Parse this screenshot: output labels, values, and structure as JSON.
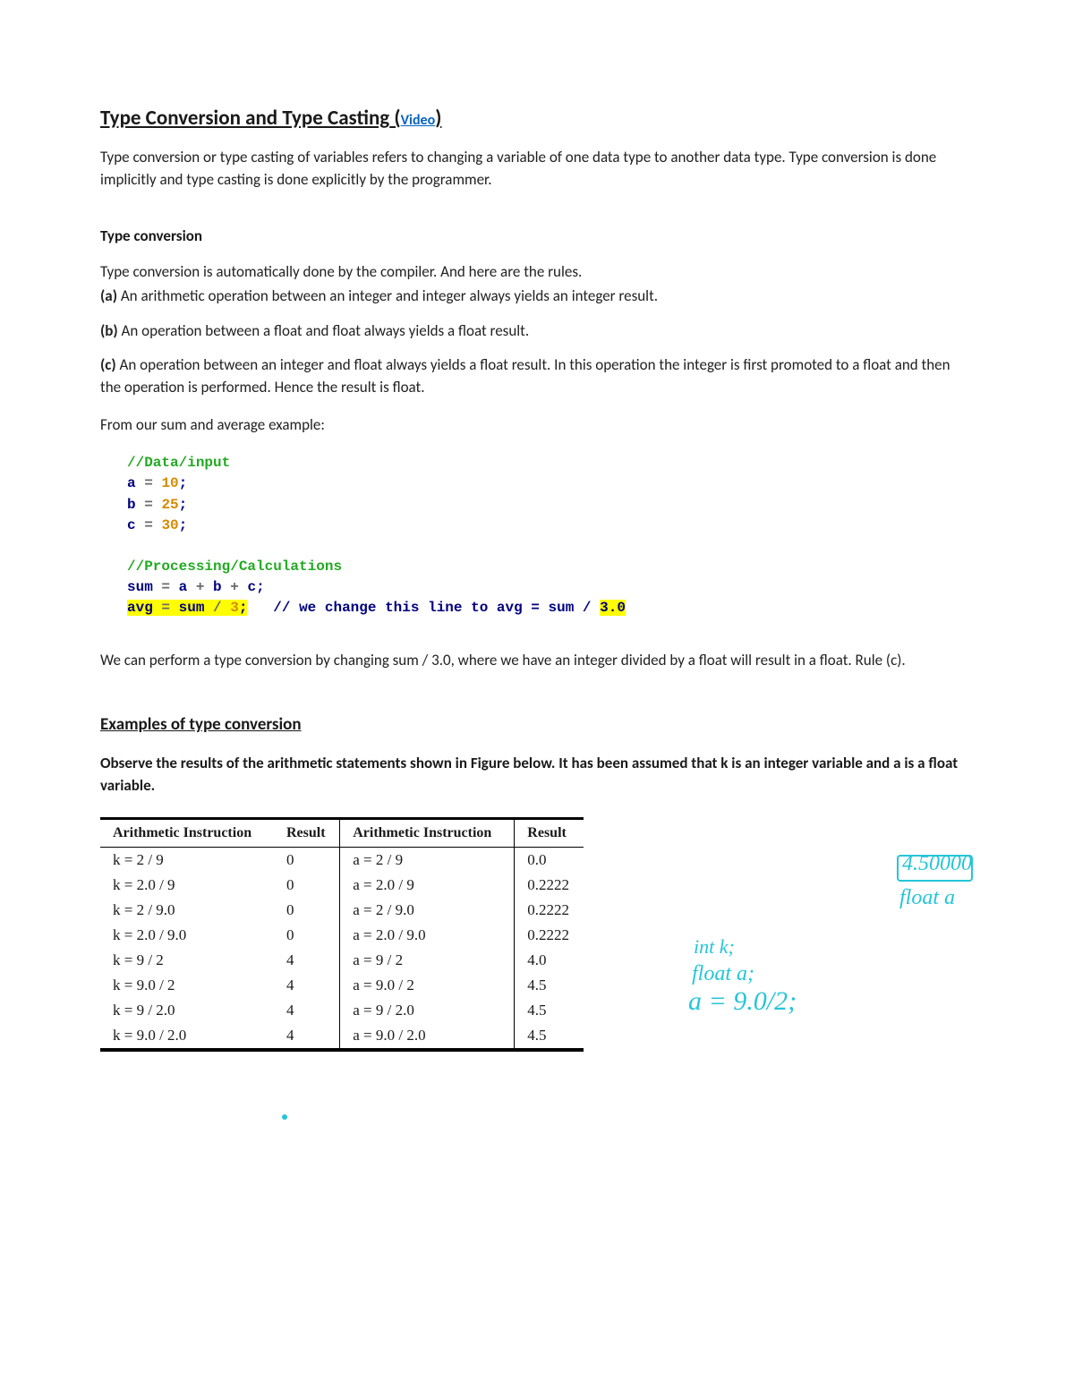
{
  "title": {
    "main": "Type Conversion and Type Casting",
    "paren_open": " (",
    "link_text": "Video",
    "paren_close": ")"
  },
  "intro": "Type conversion or type casting of variables refers to changing a variable of one data type to another data type. Type conversion is done implicitly and type casting is done explicitly by the programmer.",
  "section_heading": "Type conversion",
  "rules_intro": "Type conversion is automatically done by the compiler. And here are the rules.",
  "rule_a_prefix": "(a)",
  "rule_a_text": " An arithmetic operation between an integer and integer always yields an integer result.",
  "rule_b_prefix": "(b)",
  "rule_b_text": " An operation between a float and float always yields a float result.",
  "rule_c_prefix": "(c)",
  "rule_c_text": " An operation between an integer and float always yields a float result. In this operation the integer is first promoted to a float and then the operation is performed. Hence the result is float.",
  "from_example": "From our sum and average example:",
  "code": {
    "comment1": "//Data/input",
    "a": "a",
    "eq": "=",
    "v10": "10",
    "b": "b",
    "v25": "25",
    "c": "c",
    "v30": "30",
    "semi": ";",
    "comment2": "//Processing/Calculations",
    "sum_line": "sum ",
    "plus1": "a ",
    "plus": "+",
    "space": " ",
    "plus2": " b ",
    "plus3": " c",
    "avg": "avg ",
    "sumvar": " sum ",
    "slash": "/",
    "three": " 3",
    "comment3": "   // we change this line to avg = sum / ",
    "threezero": "3.0"
  },
  "after_code": "We can perform a type conversion by changing sum / 3.0, where we have an integer divided by a float will result in a float. Rule (c).",
  "examples_heading": "Examples of type conversion",
  "observe": "Observe the results of the arithmetic statements shown in Figure below. It has been assumed that k is an integer variable and a is a float variable.",
  "table": {
    "headers": [
      "Arithmetic Instruction",
      "Result",
      "Arithmetic Instruction",
      "Result"
    ],
    "rows": [
      [
        "k = 2 / 9",
        "0",
        "a = 2 / 9",
        "0.0"
      ],
      [
        "k = 2.0 / 9",
        "0",
        "a = 2.0 / 9",
        "0.2222"
      ],
      [
        "k = 2 / 9.0",
        "0",
        "a = 2 / 9.0",
        "0.2222"
      ],
      [
        "k = 2.0 / 9.0",
        "0",
        "a = 2.0 / 9.0",
        "0.2222"
      ],
      [
        "k = 9 / 2",
        "4",
        "a = 9 / 2",
        "4.0"
      ],
      [
        "k = 9.0 / 2",
        "4",
        "a = 9.0 / 2",
        "4.5"
      ],
      [
        "k = 9 / 2.0",
        "4",
        "a = 9 / 2.0",
        "4.5"
      ],
      [
        "k = 9.0 / 2.0",
        "4",
        "a = 9.0 / 2.0",
        "4.5"
      ]
    ]
  },
  "handwriting": {
    "box_val": "4.50000",
    "float_a": "float a",
    "line1": "int k;",
    "line2": "float a;",
    "line3": "a = 9.0/2;"
  }
}
